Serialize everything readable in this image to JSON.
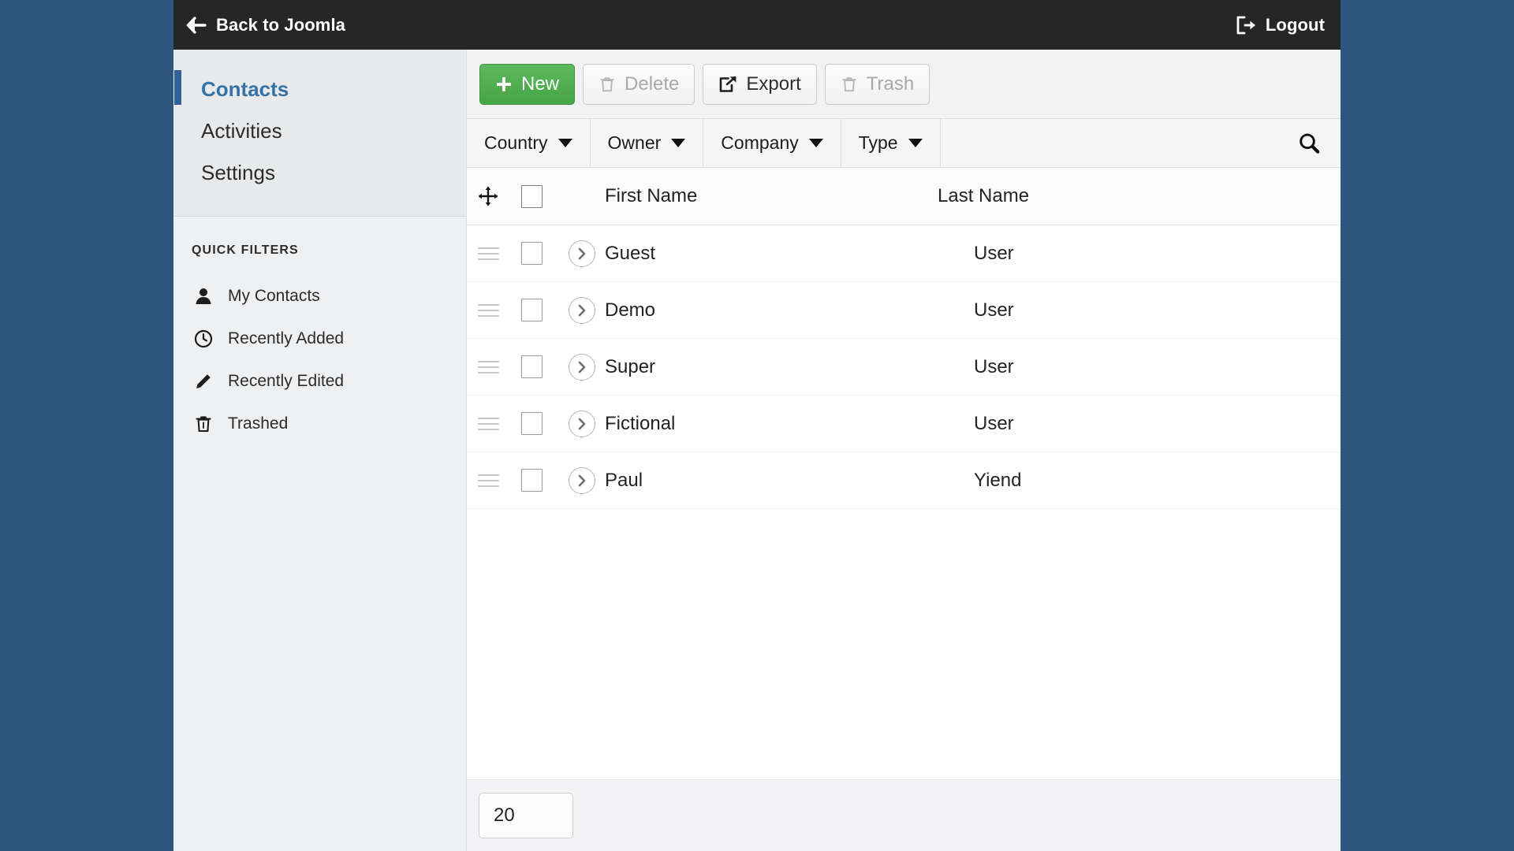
{
  "topbar": {
    "back_label": "Back to Joomla",
    "back_icon": "arrow-left-icon",
    "logout_label": "Logout",
    "logout_icon": "sign-out-icon",
    "background": "#262626"
  },
  "sidebar": {
    "nav": [
      {
        "label": "Contacts",
        "active": true
      },
      {
        "label": "Activities",
        "active": false
      },
      {
        "label": "Settings",
        "active": false
      }
    ],
    "quick_filters_title": "QUICK FILTERS",
    "quick_filters": [
      {
        "label": "My Contacts",
        "icon": "user-icon"
      },
      {
        "label": "Recently Added",
        "icon": "clock-icon"
      },
      {
        "label": "Recently Edited",
        "icon": "pencil-icon"
      },
      {
        "label": "Trashed",
        "icon": "trash-icon"
      }
    ],
    "active_accent": "#2f6098"
  },
  "toolbar": {
    "buttons": [
      {
        "label": "New",
        "icon": "plus-icon",
        "style": "primary",
        "disabled": false
      },
      {
        "label": "Delete",
        "icon": "trash-icon",
        "style": "default",
        "disabled": true
      },
      {
        "label": "Export",
        "icon": "export-icon",
        "style": "default",
        "disabled": false
      },
      {
        "label": "Trash",
        "icon": "trash-icon",
        "style": "default",
        "disabled": true
      }
    ]
  },
  "filterbar": {
    "chips": [
      {
        "label": "Country"
      },
      {
        "label": "Owner"
      },
      {
        "label": "Company"
      },
      {
        "label": "Type"
      }
    ],
    "search_icon": "search-icon",
    "search_value": "",
    "search_placeholder": ""
  },
  "table": {
    "columns": [
      "First Name",
      "Last Name"
    ],
    "rows": [
      {
        "first_name": "Guest",
        "last_name": "User",
        "selected": false
      },
      {
        "first_name": "Demo",
        "last_name": "User",
        "selected": false
      },
      {
        "first_name": "Super",
        "last_name": "User",
        "selected": false
      },
      {
        "first_name": "Fictional",
        "last_name": "User",
        "selected": false
      },
      {
        "first_name": "Paul",
        "last_name": "Yiend",
        "selected": false
      }
    ],
    "header_drag_icon": "move-icon",
    "row_drag_icon": "drag-handle-icon",
    "row_expand_icon": "chevron-right-icon",
    "select_all_checked": false
  },
  "footer": {
    "page_size_value": "20"
  }
}
